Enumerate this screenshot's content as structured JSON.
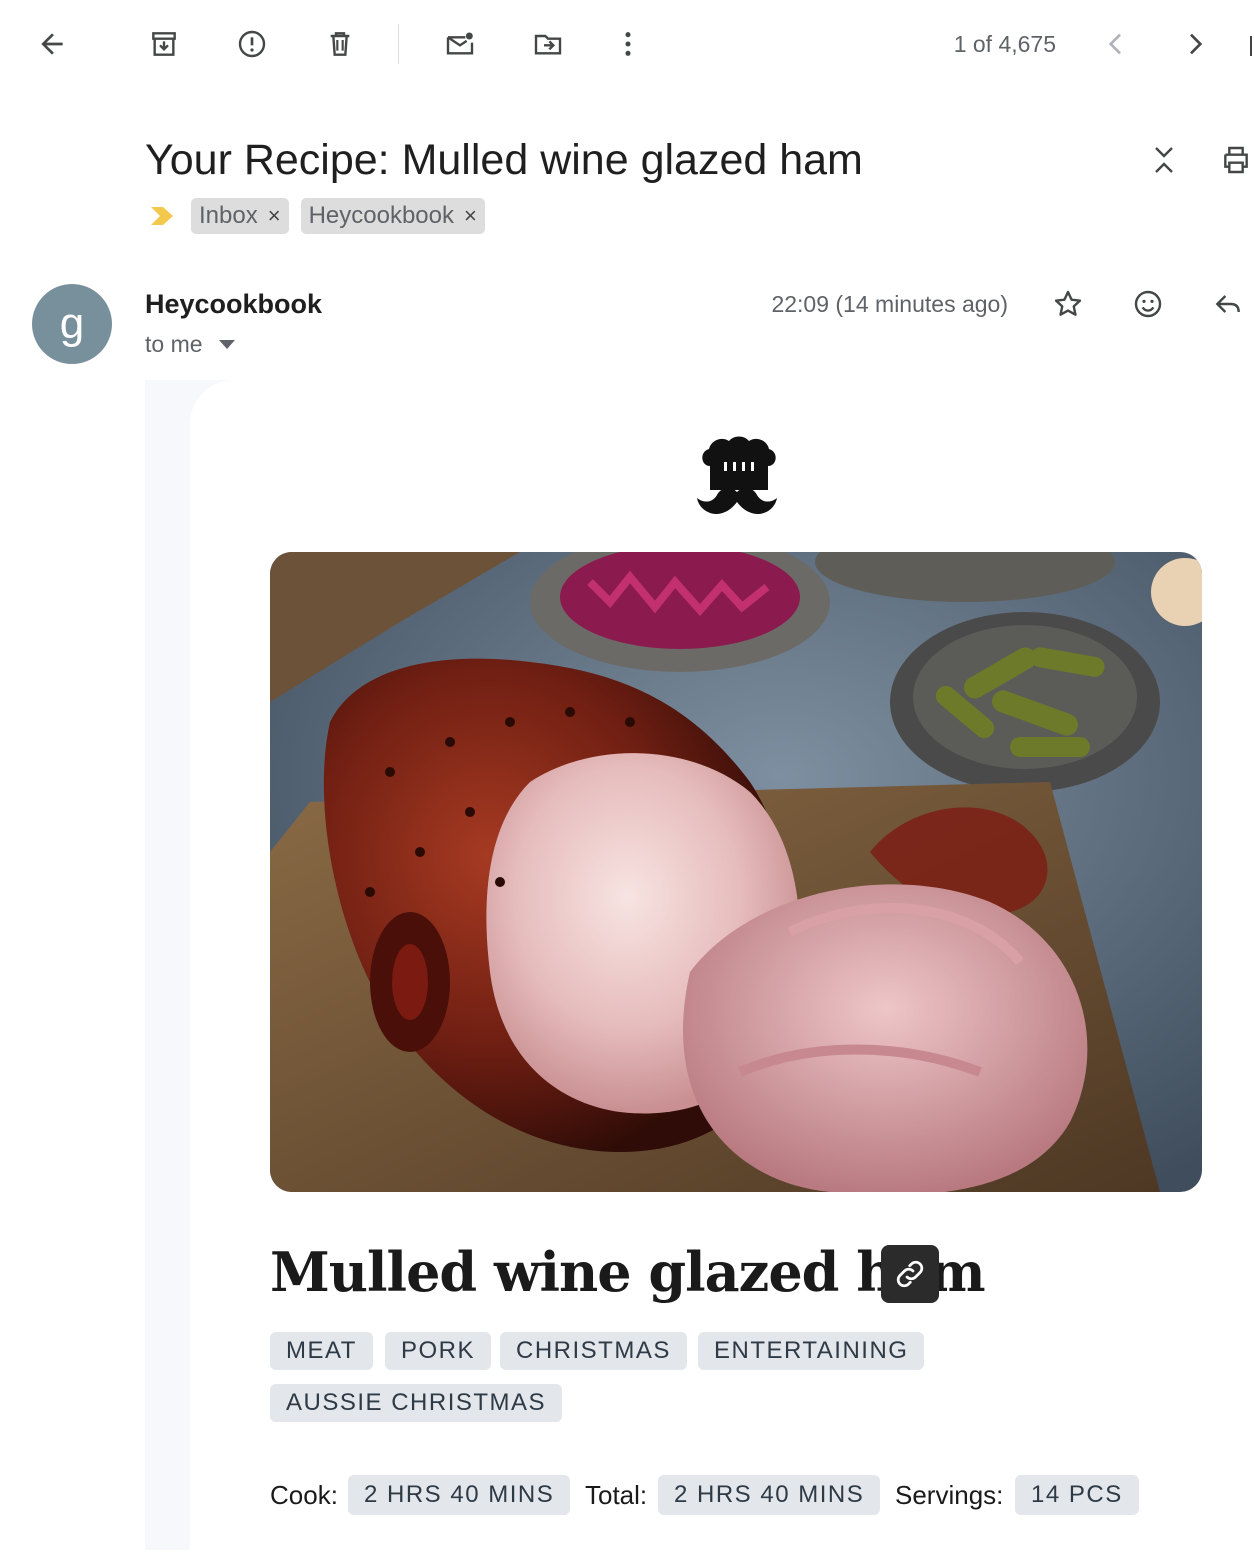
{
  "toolbar": {
    "icons": [
      "back-arrow-icon",
      "archive-icon",
      "report-spam-icon",
      "delete-icon",
      "mark-unread-icon",
      "move-to-icon",
      "more-vert-icon",
      "chevron-left-icon",
      "chevron-right-icon"
    ],
    "pager": "1 of 4,675"
  },
  "email": {
    "subject": "Your Recipe: Mulled wine glazed ham",
    "labels": [
      {
        "name": "Inbox",
        "remove": "×"
      },
      {
        "name": "Heycookbook",
        "remove": "×"
      }
    ],
    "sender": {
      "avatar_letter": "g",
      "avatar_color": "#78909c",
      "name": "Heycookbook",
      "recipient": "to me",
      "time": "22:09 (14 minutes ago)"
    }
  },
  "recipe": {
    "logo": "chef-mustache-icon",
    "image_alt": "mulled-wine-glazed-ham-photo",
    "title": "Mulled wine glazed ham",
    "tags": [
      "MEAT",
      "PORK",
      "CHRISTMAS",
      "ENTERTAINING",
      "AUSSIE CHRISTMAS"
    ],
    "meta": {
      "cook_label": "Cook:",
      "cook_value": "2 HRS 40 MINS",
      "total_label": "Total:",
      "total_value": "2 HRS 40 MINS",
      "servings_label": "Servings:",
      "servings_value": "14 PCS"
    }
  },
  "colors": {
    "importance_marker": "#f2c94c",
    "tag_bg": "#e3e6ea",
    "chip_bg": "#dddddd"
  }
}
